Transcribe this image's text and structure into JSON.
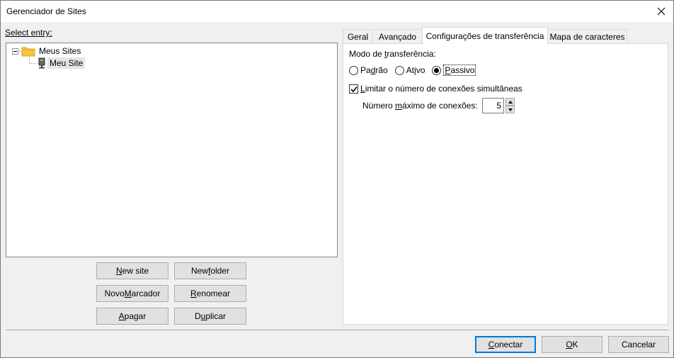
{
  "window": {
    "title": "Gerenciador de Sites"
  },
  "left": {
    "select_entry_label": "Select entry:",
    "tree": {
      "folder": {
        "label": "Meus Sites"
      },
      "site": {
        "label": "Meu Site"
      }
    },
    "buttons": {
      "new_site": {
        "pre": "",
        "ul": "N",
        "post": "ew site"
      },
      "new_folder": {
        "pre": "New ",
        "ul": "f",
        "post": "older"
      },
      "new_bookmark": {
        "pre": "Novo ",
        "ul": "M",
        "post": "arcador"
      },
      "rename": {
        "pre": "",
        "ul": "R",
        "post": "enomear"
      },
      "delete": {
        "pre": "",
        "ul": "A",
        "post": "pagar"
      },
      "duplicate": {
        "pre": "D",
        "ul": "u",
        "post": "plicar"
      }
    }
  },
  "tabs": [
    {
      "label": "Geral"
    },
    {
      "label": "Avançado"
    },
    {
      "label": "Configurações de transferência"
    },
    {
      "label": "Mapa de caracteres"
    }
  ],
  "transfer": {
    "mode_label": {
      "pre": "Modo de ",
      "ul": "t",
      "post": "ransferência:"
    },
    "modes": [
      {
        "pre": "Pa",
        "ul": "d",
        "post": "rão",
        "checked": false
      },
      {
        "pre": "At",
        "ul": "i",
        "post": "vo",
        "checked": false
      },
      {
        "pre": "",
        "ul": "P",
        "post": "assivo",
        "checked": true
      }
    ],
    "limit_checkbox": {
      "pre": "",
      "ul": "L",
      "post": "imitar o número de conexões simultâneas",
      "checked": true
    },
    "max_connections": {
      "pre": "Número ",
      "ul": "m",
      "post": "áximo de conexões:",
      "value": "5"
    }
  },
  "footer": {
    "connect": {
      "pre": "",
      "ul": "C",
      "post": "onectar"
    },
    "ok": {
      "pre": "",
      "ul": "O",
      "post": "K"
    },
    "cancel": {
      "label": "Cancelar"
    }
  },
  "colors": {
    "folder": "#f5c542",
    "accent": "#0078d7"
  }
}
